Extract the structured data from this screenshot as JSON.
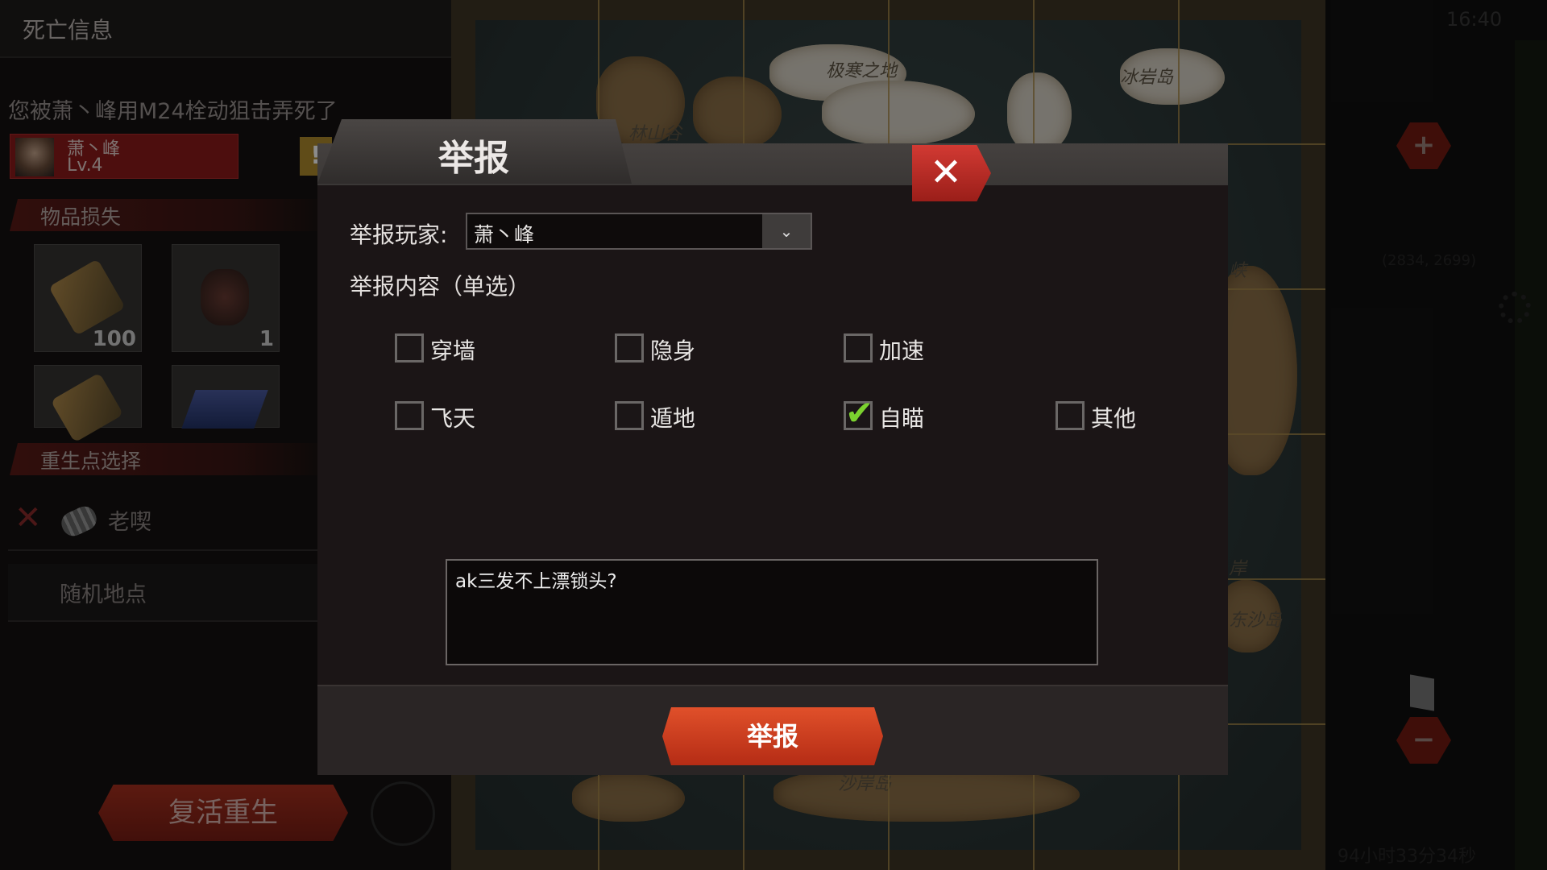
{
  "death_panel": {
    "header": "死亡信息",
    "killed_message": "您被萧丶峰用M24栓动狙击弄死了",
    "killer_name": "萧丶峰",
    "killer_level": "Lv.4",
    "report_flag": "!",
    "items_lost_title": "物品损失",
    "items": [
      {
        "icon": "ammo-icon",
        "count": "100"
      },
      {
        "icon": "gloves-icon",
        "count": "1"
      },
      {
        "icon": "ammo-icon",
        "count": ""
      },
      {
        "icon": "bullets-icon",
        "count": ""
      }
    ],
    "respawn_title": "重生点选择",
    "respawn_option": "老喫",
    "random_location": "随机地点",
    "revive_button": "复活重生"
  },
  "map": {
    "labels": [
      "极寒之地",
      "冰岩岛",
      "林山谷",
      "峡",
      "岸",
      "东沙岛",
      "沙岸岛"
    ],
    "clock": "16:40",
    "coords": "(2834, 2699)",
    "timer": "94小时33分34秒",
    "zoom_in": "+",
    "zoom_out": "−"
  },
  "dialog": {
    "title": "举报",
    "close_icon": "✕",
    "player_label": "举报玩家:",
    "player_value": "萧丶峰",
    "dropdown_icon": "⌄",
    "content_label": "举报内容（单选）",
    "options": [
      {
        "label": "穿墙",
        "checked": false
      },
      {
        "label": "隐身",
        "checked": false
      },
      {
        "label": "加速",
        "checked": false
      },
      {
        "label": "飞天",
        "checked": false
      },
      {
        "label": "遁地",
        "checked": false
      },
      {
        "label": "自瞄",
        "checked": true
      },
      {
        "label": "其他",
        "checked": false
      }
    ],
    "report_text": "ak三发不上漂锁头?",
    "submit_button": "举报"
  },
  "colors": {
    "accent_red": "#c0392b",
    "check_green": "#7bd22f",
    "panel_dark": "#1b1516"
  }
}
